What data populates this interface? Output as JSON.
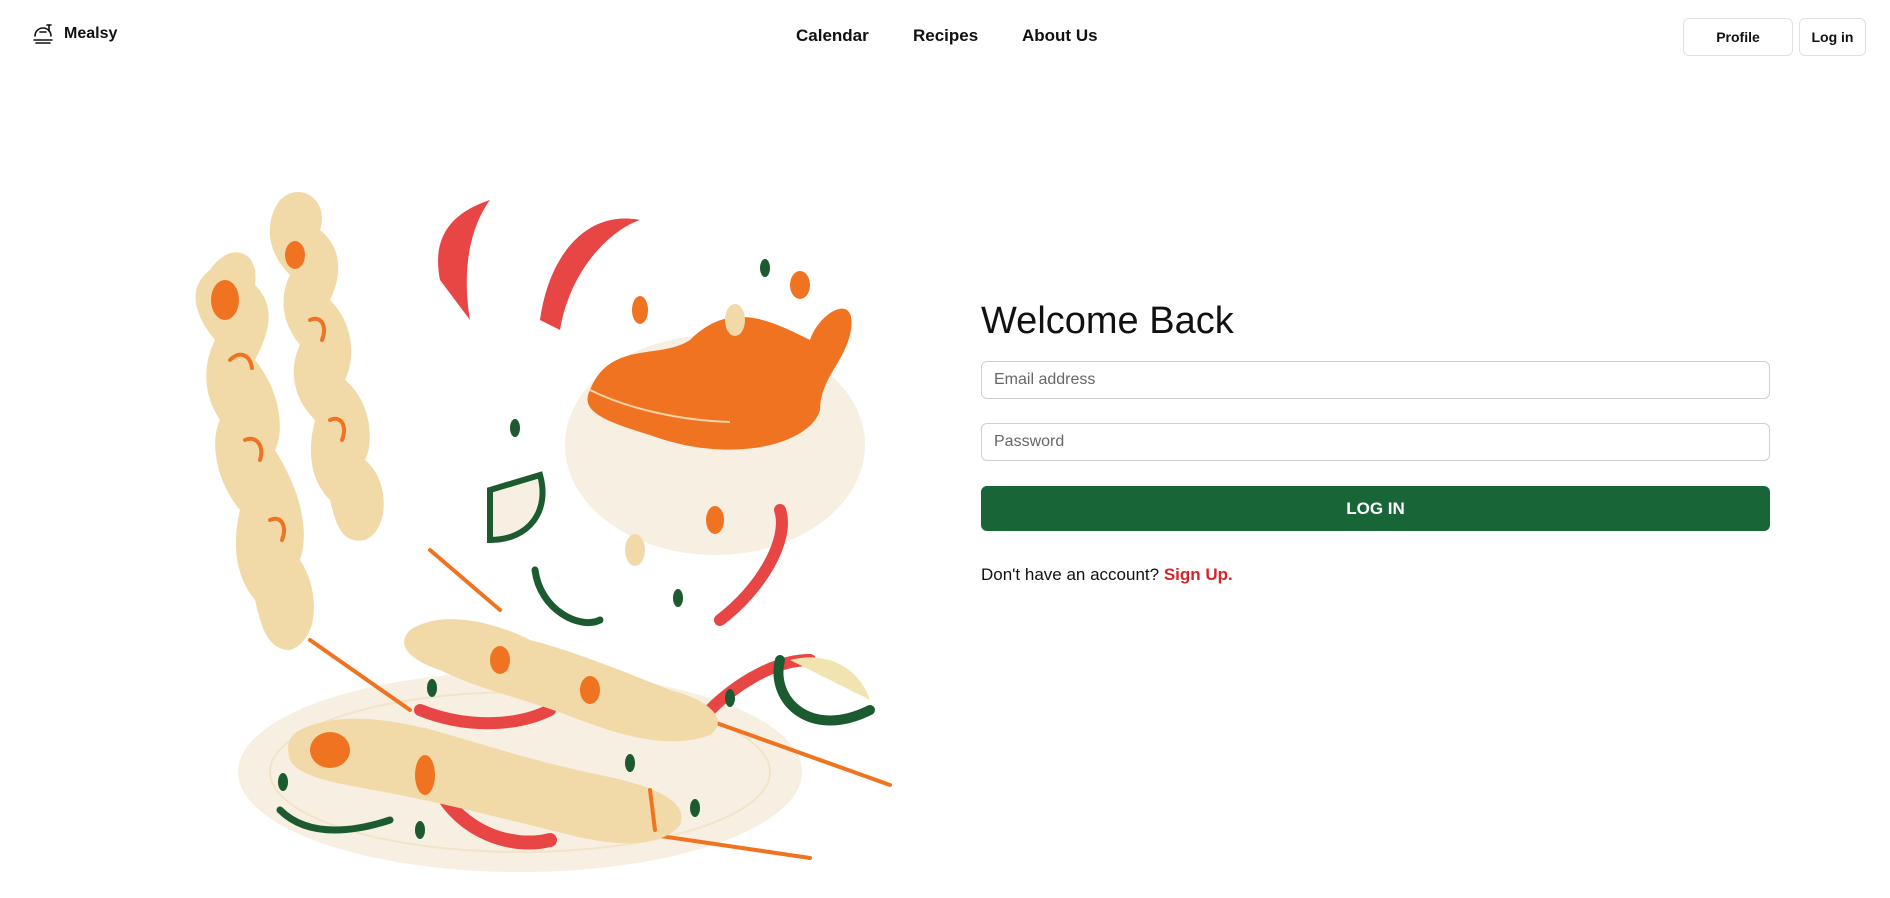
{
  "header": {
    "brand": "Mealsy",
    "nav": [
      "Calendar",
      "Recipes",
      "About Us"
    ],
    "profile_label": "Profile",
    "login_label": "Log in"
  },
  "login": {
    "title": "Welcome Back",
    "email_placeholder": "Email address",
    "password_placeholder": "Password",
    "submit_label": "LOG IN",
    "signup_prompt": "Don't have an account?",
    "signup_link": "Sign Up."
  },
  "colors": {
    "primary_green": "#186637",
    "link_red": "#d3252b",
    "orange": "#ef7320",
    "beige": "#f2d9a8",
    "cream": "#f6efe2",
    "dark_green": "#1c5b2f",
    "red": "#e84545"
  },
  "icons": {
    "brand_logo": "food-tray-icon"
  }
}
